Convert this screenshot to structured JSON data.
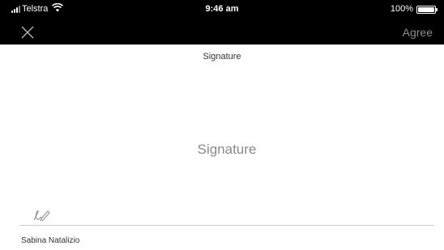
{
  "status_bar": {
    "carrier": "Telstra",
    "time": "9:46 am",
    "battery_percent": "100%",
    "icons": [
      "signal-icon",
      "wifi-icon",
      "battery-icon"
    ]
  },
  "nav": {
    "close_icon": "close-icon",
    "agree_label": "Agree"
  },
  "page": {
    "title": "Signature",
    "placeholder": "Signature",
    "signer_name": "Sabina Natalizio"
  },
  "colors": {
    "header_bg": "#000000",
    "agree_disabled": "#8d8d8d",
    "placeholder": "#8a8a8a",
    "line": "#cfcfcf"
  }
}
